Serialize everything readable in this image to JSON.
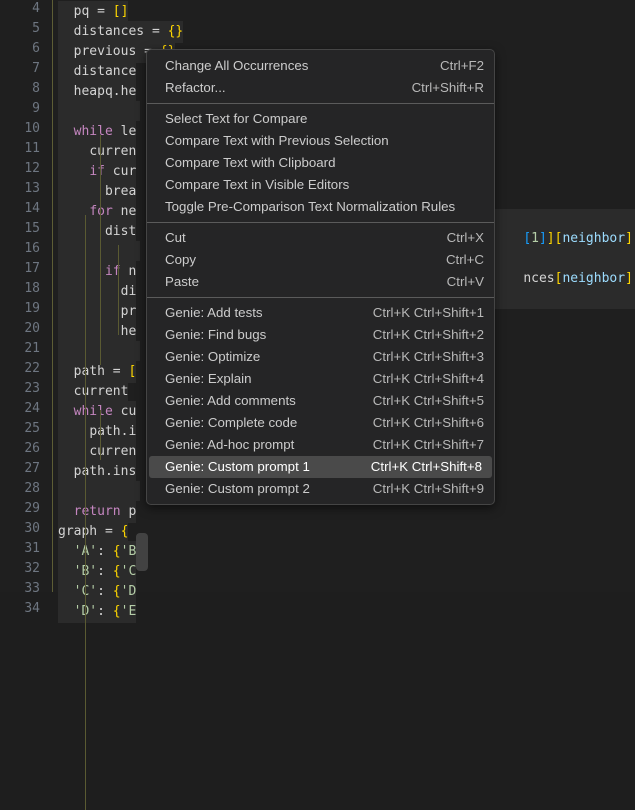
{
  "editor": {
    "language": "python",
    "first_line_number": 4,
    "colors": {
      "background": "#1f1f1f",
      "selection": "#2b2b2b",
      "line_number": "#6e7681",
      "indent_guide": "#5a5a32"
    },
    "lines": [
      {
        "n": "4",
        "text": "  pq = []"
      },
      {
        "n": "5",
        "text": "  distances = {}"
      },
      {
        "n": "6",
        "text": "  previous = {}"
      },
      {
        "n": "7",
        "text": "  distance"
      },
      {
        "n": "8",
        "text": "  heapq.he"
      },
      {
        "n": "9",
        "text": ""
      },
      {
        "n": "10",
        "text": "  while le"
      },
      {
        "n": "11",
        "text": "    curren"
      },
      {
        "n": "12",
        "text": "    if cur"
      },
      {
        "n": "13",
        "text": "      brea"
      },
      {
        "n": "14",
        "text": "    for ne"
      },
      {
        "n": "15",
        "text": "      dist"
      },
      {
        "n": "16",
        "text": ""
      },
      {
        "n": "17",
        "text": "      if n"
      },
      {
        "n": "18",
        "text": "        di"
      },
      {
        "n": "19",
        "text": "        pr"
      },
      {
        "n": "20",
        "text": "        he"
      },
      {
        "n": "21",
        "text": ""
      },
      {
        "n": "22",
        "text": "  path = ["
      },
      {
        "n": "23",
        "text": "  current"
      },
      {
        "n": "24",
        "text": "  while cu"
      },
      {
        "n": "25",
        "text": "    path.i"
      },
      {
        "n": "26",
        "text": "    curren"
      },
      {
        "n": "27",
        "text": "  path.ins"
      },
      {
        "n": "28",
        "text": ""
      },
      {
        "n": "29",
        "text": "  return p"
      },
      {
        "n": "30",
        "text": "graph = {"
      },
      {
        "n": "31",
        "text": "  'A': {'B"
      },
      {
        "n": "32",
        "text": "  'B': {'C"
      },
      {
        "n": "33",
        "text": "  'C': {'D"
      },
      {
        "n": "34",
        "text": "  'D': {'E"
      }
    ],
    "right_fragments": [
      {
        "text": "[1]][neighbor]",
        "line": "15"
      },
      {
        "text": "nces[neighbor]:",
        "line": "17"
      }
    ]
  },
  "context_menu": {
    "selected_index": 17,
    "groups": [
      {
        "items": [
          {
            "label": "Change All Occurrences",
            "shortcut": "Ctrl+F2"
          },
          {
            "label": "Refactor...",
            "shortcut": "Ctrl+Shift+R"
          }
        ]
      },
      {
        "items": [
          {
            "label": "Select Text for Compare",
            "shortcut": ""
          },
          {
            "label": "Compare Text with Previous Selection",
            "shortcut": ""
          },
          {
            "label": "Compare Text with Clipboard",
            "shortcut": ""
          },
          {
            "label": "Compare Text in Visible Editors",
            "shortcut": ""
          },
          {
            "label": "Toggle Pre-Comparison Text Normalization Rules",
            "shortcut": ""
          }
        ]
      },
      {
        "items": [
          {
            "label": "Cut",
            "shortcut": "Ctrl+X"
          },
          {
            "label": "Copy",
            "shortcut": "Ctrl+C"
          },
          {
            "label": "Paste",
            "shortcut": "Ctrl+V"
          }
        ]
      },
      {
        "items": [
          {
            "label": "Genie: Add tests",
            "shortcut": "Ctrl+K Ctrl+Shift+1"
          },
          {
            "label": "Genie: Find bugs",
            "shortcut": "Ctrl+K Ctrl+Shift+2"
          },
          {
            "label": "Genie: Optimize",
            "shortcut": "Ctrl+K Ctrl+Shift+3"
          },
          {
            "label": "Genie: Explain",
            "shortcut": "Ctrl+K Ctrl+Shift+4"
          },
          {
            "label": "Genie: Add comments",
            "shortcut": "Ctrl+K Ctrl+Shift+5"
          },
          {
            "label": "Genie: Complete code",
            "shortcut": "Ctrl+K Ctrl+Shift+6"
          },
          {
            "label": "Genie: Ad-hoc prompt",
            "shortcut": "Ctrl+K Ctrl+Shift+7"
          },
          {
            "label": "Genie: Custom prompt 1",
            "shortcut": "Ctrl+K Ctrl+Shift+8",
            "selected": true
          },
          {
            "label": "Genie: Custom prompt 2",
            "shortcut": "Ctrl+K Ctrl+Shift+9"
          }
        ]
      }
    ],
    "colors": {
      "background": "#252526",
      "border": "#454545",
      "selected_background": "#4a4a4a",
      "text": "#cccccc",
      "shortcut_text": "#b8b8b8",
      "separator": "#5b5b5b"
    }
  },
  "scrollbar": {
    "name": "vertical-scrollbar-thumb",
    "color": "#797979"
  }
}
